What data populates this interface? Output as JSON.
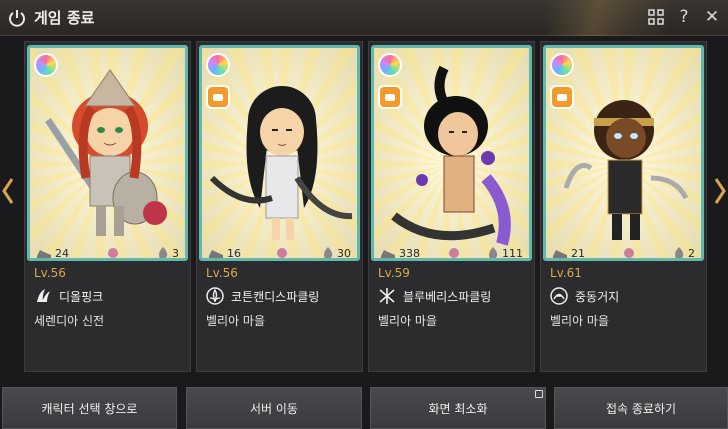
{
  "window": {
    "title": "게임 종료",
    "icons": [
      "power-icon",
      "grid-icon",
      "help-icon",
      "close-icon"
    ]
  },
  "nav": {
    "prev_icon": "chevron-left-icon",
    "next_icon": "chevron-right-icon"
  },
  "characters": [
    {
      "level": "Lv.56",
      "name": "디올핑크",
      "location": "세렌디아 신전",
      "left_stat": "24",
      "right_stat": "3",
      "class_icon": "wing-class-icon"
    },
    {
      "level": "Lv.56",
      "name": "코튼캔디스파클링",
      "location": "벨리아 마을",
      "left_stat": "16",
      "right_stat": "30",
      "class_icon": "lotus-class-icon"
    },
    {
      "level": "Lv.59",
      "name": "블루베리스파클링",
      "location": "벨리아 마을",
      "left_stat": "338",
      "right_stat": "111",
      "class_icon": "rune-class-icon"
    },
    {
      "level": "Lv.61",
      "name": "중동거지",
      "location": "벨리아 마을",
      "left_stat": "21",
      "right_stat": "2",
      "class_icon": "circle-class-icon"
    }
  ],
  "buttons": {
    "character_select": "캐릭터 선택 창으로",
    "server_move": "서버 이동",
    "minimize": "화면 최소화",
    "quit": "접속 종료하기"
  },
  "colors": {
    "accent": "#d7a94e",
    "portrait_border": "#5fb9ae"
  }
}
